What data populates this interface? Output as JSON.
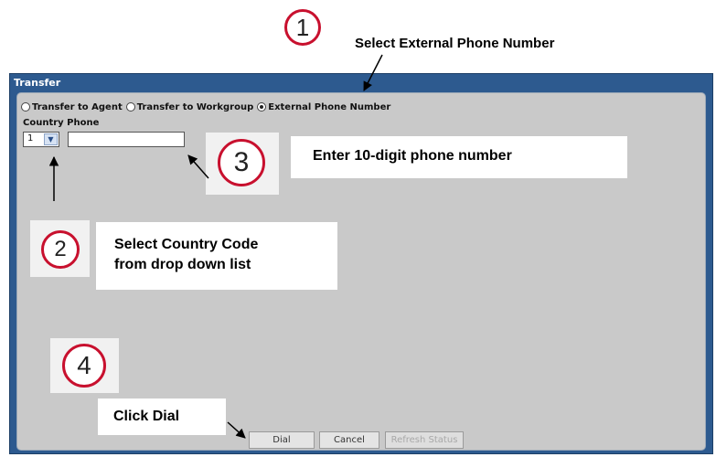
{
  "window": {
    "title": "Transfer"
  },
  "transfer_options": [
    {
      "label": "Transfer to Agent",
      "selected": false
    },
    {
      "label": "Transfer to Workgroup",
      "selected": false
    },
    {
      "label": "External Phone Number",
      "selected": true
    }
  ],
  "fields": {
    "label": "Country Phone",
    "country_code": "1",
    "phone_value": ""
  },
  "buttons": {
    "dial": "Dial",
    "cancel": "Cancel",
    "refresh": "Refresh Status"
  },
  "callouts": {
    "step1_number": "1",
    "step1_text": "Select External Phone Number",
    "step2_number": "2",
    "step2_text_line1": "Select Country Code",
    "step2_text_line2": "from drop down list",
    "step3_number": "3",
    "step3_text": "Enter 10-digit phone number",
    "step4_number": "4",
    "step4_text": "Click Dial"
  },
  "colors": {
    "window_frame": "#2d5a8f",
    "panel": "#c9c9c9",
    "callout_ring": "#c8102e"
  }
}
